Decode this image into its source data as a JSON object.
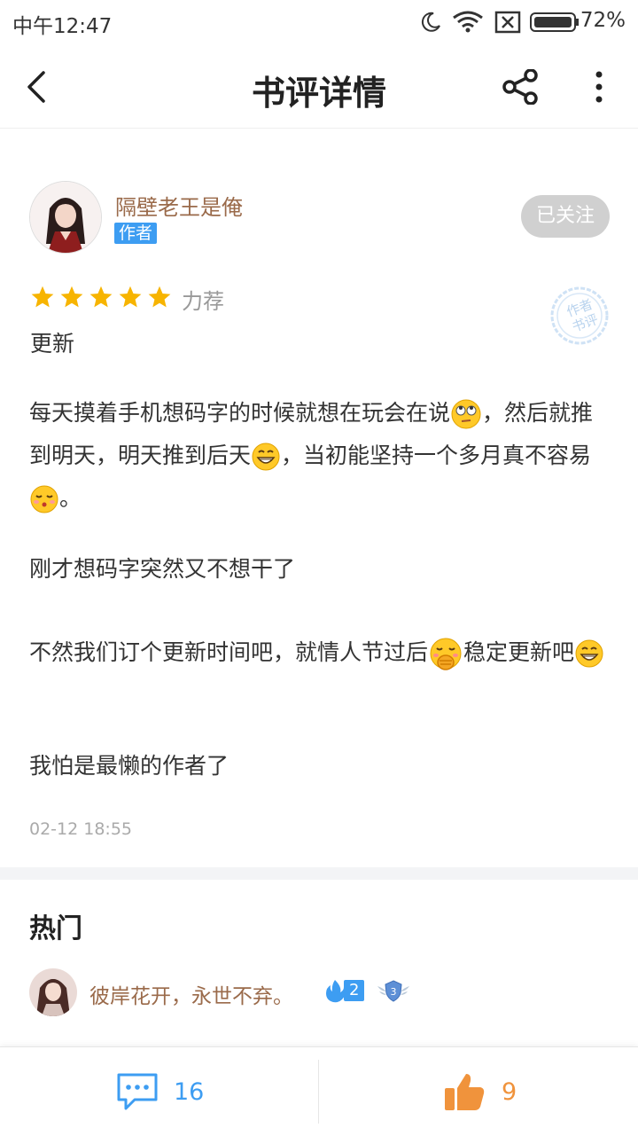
{
  "status_bar": {
    "time": "中午12:47",
    "battery": "72%"
  },
  "nav": {
    "title": "书评详情"
  },
  "author": {
    "name": "隔壁老王是俺",
    "tag": "作者",
    "follow_label": "已关注"
  },
  "rating": {
    "stars": 5,
    "label": "力荐"
  },
  "review": {
    "title": "更新",
    "paragraphs": [
      [
        "每天摸着手机想码字的时候就想在玩会在说",
        "，然后就推到明天，明天推到后天",
        "，当初能坚持一个多月真不容易",
        "。"
      ],
      [
        "刚才想码字突然又不想干了"
      ],
      [
        "不然我们订个更新时间吧，就情人节过后",
        "稳定更新吧"
      ],
      [
        "我怕是最懒的作者了"
      ]
    ],
    "time": "02-12 18:55",
    "stamp_text": "作者书评"
  },
  "hot": {
    "title": "热门",
    "first_comment": {
      "name": "彼岸花开，永世不弃。",
      "level": "2",
      "rank": "3"
    }
  },
  "bottom_bar": {
    "comment_count": "16",
    "like_count": "9"
  },
  "colors": {
    "accent_blue": "#3d9df2",
    "author_brown": "#9a6a4a",
    "star_yellow": "#f7b400",
    "like_orange": "#f0933c"
  },
  "icons": [
    "moon-icon",
    "wifi-icon",
    "sim-icon",
    "battery-icon",
    "back-icon",
    "share-icon",
    "more-icon",
    "star-icon",
    "comment-icon",
    "thumbs-up-icon",
    "fire-icon",
    "wing-badge-icon"
  ]
}
